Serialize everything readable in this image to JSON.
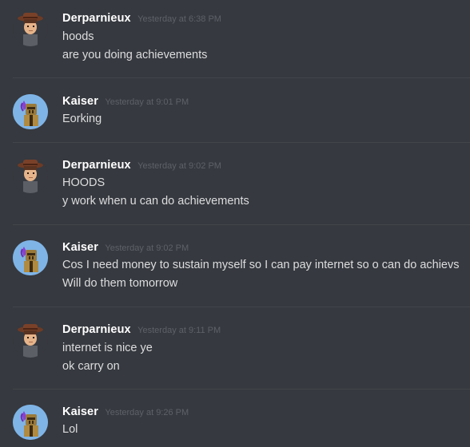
{
  "messages": [
    {
      "author": "Derparnieux",
      "avatar_icon": "cowboy-hat-man-avatar",
      "timestamp": "Yesterday at 6:38 PM",
      "lines": [
        "hoods",
        "are you doing achievements"
      ]
    },
    {
      "author": "Kaiser",
      "avatar_icon": "purple-plume-knight-avatar",
      "timestamp": "Yesterday at 9:01 PM",
      "lines": [
        "Eorking"
      ]
    },
    {
      "author": "Derparnieux",
      "avatar_icon": "cowboy-hat-man-avatar",
      "timestamp": "Yesterday at 9:02 PM",
      "lines": [
        "HOODS",
        "y work when u can do achievements"
      ]
    },
    {
      "author": "Kaiser",
      "avatar_icon": "purple-plume-knight-avatar",
      "timestamp": "Yesterday at 9:02 PM",
      "lines": [
        "Cos I need money to sustain myself so I can pay internet so o can do achievs",
        "Will do them tomorrow"
      ]
    },
    {
      "author": "Derparnieux",
      "avatar_icon": "cowboy-hat-man-avatar",
      "timestamp": "Yesterday at 9:11 PM",
      "lines": [
        "internet is nice ye",
        "ok carry on"
      ]
    },
    {
      "author": "Kaiser",
      "avatar_icon": "purple-plume-knight-avatar",
      "timestamp": "Yesterday at 9:26 PM",
      "lines": [
        "Lol"
      ]
    }
  ],
  "colors": {
    "background": "#36393f",
    "username": "#ffffff",
    "message_text": "#dcddde",
    "timestamp": "#5e6168",
    "divider": "#42454a",
    "kaiser_avatar_bg": "#7fb4e6"
  }
}
